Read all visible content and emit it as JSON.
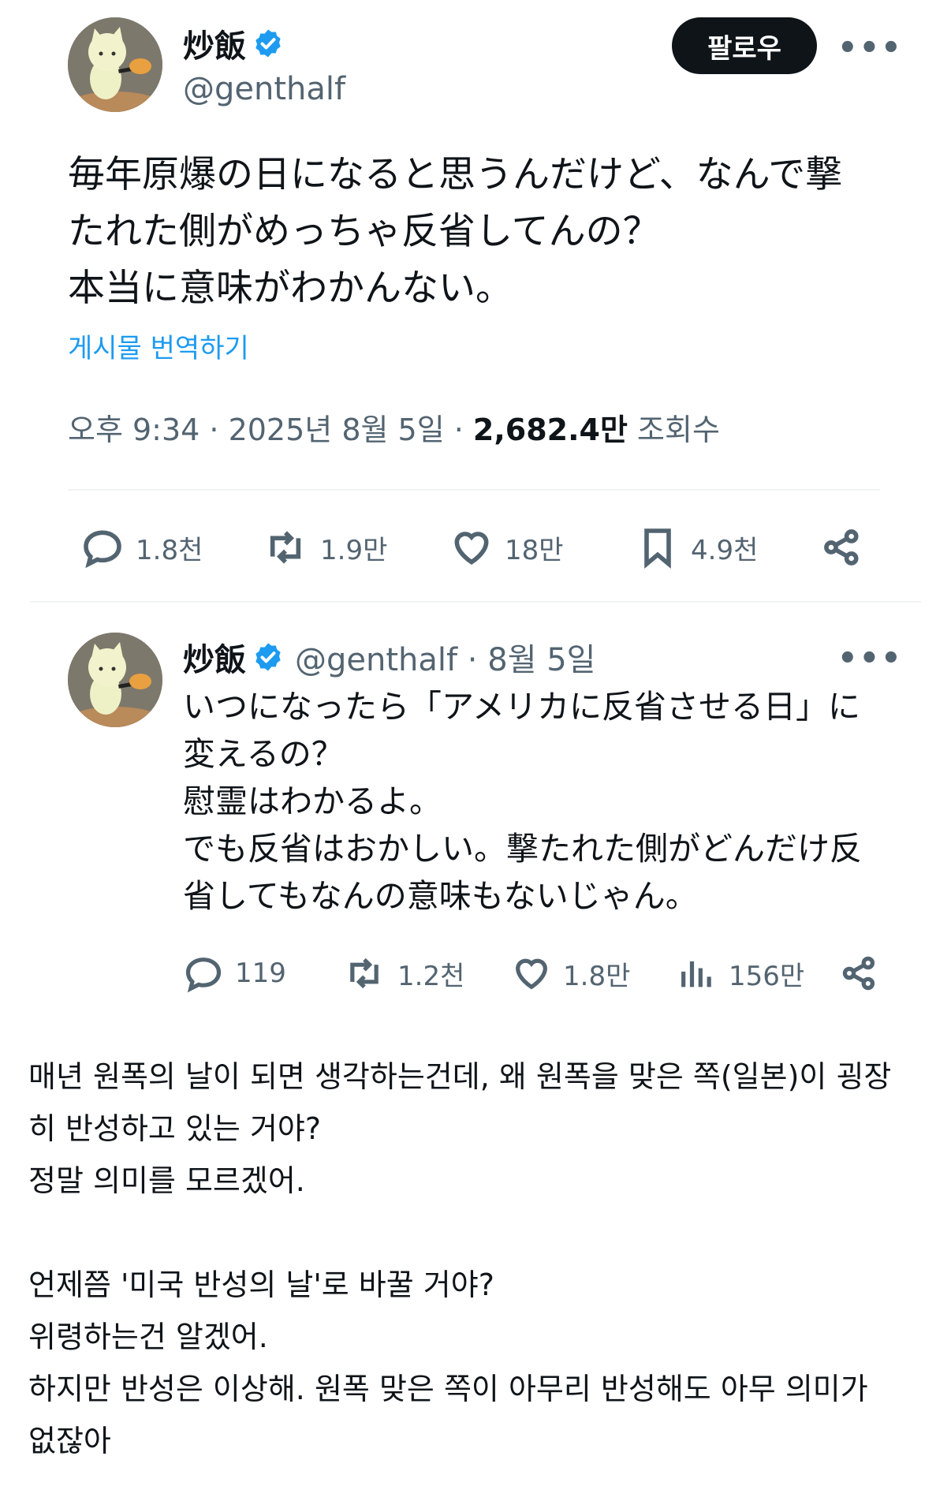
{
  "main_tweet": {
    "author_name": "炒飯",
    "author_handle": "@genthalf",
    "follow_label": "팔로우",
    "more_label": "•••",
    "text": "毎年原爆の日になると思うんだけど、なんで撃\nたれた側がめっちゃ反省してんの？\n本当に意味がわかんない。",
    "translate_label": "게시물 번역하기",
    "time": "오후 9:34 · 2025년 8월 5일 · ",
    "views_count": "2,682.4만",
    "views_label": " 조회수",
    "stats": {
      "replies": "1.8천",
      "retweets": "1.9만",
      "likes": "18만",
      "bookmarks": "4.9천"
    }
  },
  "reply_tweet": {
    "author_name": "炒飯",
    "author_handle_date": "@genthalf · 8월 5일",
    "more_label": "•••",
    "text": "いつになったら「アメリカに反省させる日」に\n変えるの？\n慰霊はわかるよ。\nでも反省はおかしい。撃たれた側がどんだけ反\n省してもなんの意味もないじゃん。",
    "stats": {
      "replies": "119",
      "retweets": "1.2천",
      "likes": "1.8만",
      "views": "156만"
    }
  },
  "translation_text": "매년 원폭의 날이 되면 생각하는건데, 왜 원폭을 맞은 쪽(일본)이 굉장\n히 반성하고 있는 거야?\n정말 의미를 모르겠어.\n\n언제쯤 '미국 반성의 날'로 바꿀 거야?\n위령하는건 알겠어.\n하지만 반성은 이상해. 원폭 맞은 쪽이 아무리 반성해도 아무 의미가\n없잖아",
  "colors": {
    "text_primary": "#0f1419",
    "text_secondary": "#536471",
    "link_blue": "#1d9bf0",
    "verified_blue": "#1d9bf0",
    "divider": "#eff3f4"
  },
  "icons": [
    "verified-badge-icon",
    "reply-icon",
    "retweet-icon",
    "like-icon",
    "bookmark-icon",
    "share-icon",
    "views-icon",
    "more-icon"
  ]
}
